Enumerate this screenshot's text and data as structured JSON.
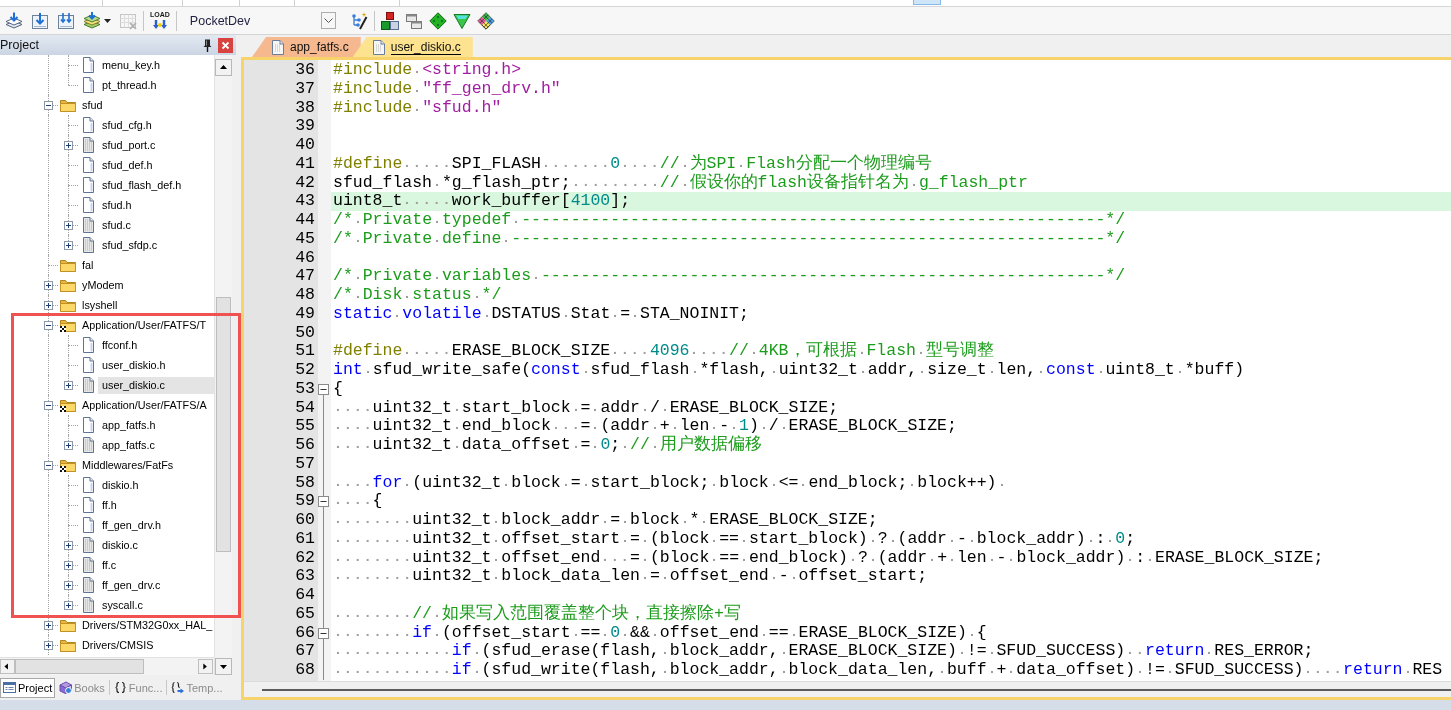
{
  "toolbar": {
    "groups": [
      {
        "buttons": [
          {
            "kind": "pages_arrow",
            "disabled": false
          },
          {
            "kind": "box_arrow",
            "disabled": false
          },
          {
            "kind": "box_arrows",
            "disabled": false
          },
          {
            "kind": "layers_arrow",
            "disabled": false
          },
          {
            "kind": "caret",
            "disabled": false
          },
          {
            "kind": "grid_cross",
            "disabled": true
          }
        ]
      },
      {
        "buttons": [
          {
            "kind": "load",
            "label": "LOAD",
            "disabled": false
          }
        ]
      },
      {
        "target": "PocketDev",
        "buttons": [
          {
            "kind": "wand",
            "disabled": false
          }
        ]
      },
      {
        "buttons": [
          {
            "kind": "blocks",
            "disabled": false
          },
          {
            "kind": "windows",
            "disabled": false
          },
          {
            "kind": "diamond",
            "disabled": false
          },
          {
            "kind": "funnel",
            "disabled": false
          },
          {
            "kind": "diamond_grid",
            "disabled": false
          }
        ]
      }
    ]
  },
  "project_panel": {
    "title": "Project",
    "tree": [
      {
        "highlighted": false,
        "children": [
          {
            "label": "menu_key.h",
            "kind": "header",
            "selected": false
          },
          {
            "label": "pt_thread.h",
            "kind": "header",
            "selected": false
          }
        ]
      },
      {
        "label": "sfud",
        "kind": "group",
        "expanded": true,
        "selected": false,
        "highlighted": false,
        "children": [
          {
            "label": "sfud_cfg.h",
            "kind": "header",
            "selected": false
          },
          {
            "label": "sfud_port.c",
            "kind": "source",
            "expanded": false,
            "selected": false
          },
          {
            "label": "sfud_def.h",
            "kind": "header",
            "selected": false
          },
          {
            "label": "sfud_flash_def.h",
            "kind": "header",
            "selected": false
          },
          {
            "label": "sfud.h",
            "kind": "header",
            "selected": false
          },
          {
            "label": "sfud.c",
            "kind": "source",
            "expanded": false,
            "selected": false
          },
          {
            "label": "sfud_sfdp.c",
            "kind": "source",
            "expanded": false,
            "selected": false
          }
        ]
      },
      {
        "label": "fal",
        "kind": "group",
        "selected": false,
        "highlighted": false
      },
      {
        "label": "yModem",
        "kind": "group",
        "expanded": false,
        "selected": false,
        "highlighted": false
      },
      {
        "label": "lsyshell",
        "kind": "group",
        "expanded": false,
        "selected": false,
        "highlighted": false
      },
      {
        "label": "Application/User/FATFS/T",
        "kind": "option_group",
        "expanded": true,
        "selected": false,
        "highlighted": true,
        "children": [
          {
            "label": "ffconf.h",
            "kind": "header",
            "selected": false
          },
          {
            "label": "user_diskio.h",
            "kind": "header",
            "selected": false
          },
          {
            "label": "user_diskio.c",
            "kind": "source",
            "expanded": false,
            "selected": true
          }
        ]
      },
      {
        "label": "Application/User/FATFS/A",
        "kind": "option_group",
        "expanded": true,
        "selected": false,
        "highlighted": true,
        "children": [
          {
            "label": "app_fatfs.h",
            "kind": "header",
            "selected": false
          },
          {
            "label": "app_fatfs.c",
            "kind": "source",
            "expanded": false,
            "selected": false
          }
        ]
      },
      {
        "label": "Middlewares/FatFs",
        "kind": "option_group",
        "expanded": true,
        "selected": false,
        "highlighted": true,
        "children": [
          {
            "label": "diskio.h",
            "kind": "header",
            "selected": false
          },
          {
            "label": "ff.h",
            "kind": "header",
            "selected": false
          },
          {
            "label": "ff_gen_drv.h",
            "kind": "header",
            "selected": false
          },
          {
            "label": "diskio.c",
            "kind": "source",
            "expanded": false,
            "selected": false
          },
          {
            "label": "ff.c",
            "kind": "source",
            "expanded": false,
            "selected": false
          },
          {
            "label": "ff_gen_drv.c",
            "kind": "source",
            "expanded": false,
            "selected": false
          },
          {
            "label": "syscall.c",
            "kind": "source",
            "expanded": false,
            "selected": false
          }
        ]
      },
      {
        "label": "Drivers/STM32G0xx_HAL_",
        "kind": "group",
        "expanded": false,
        "selected": false,
        "highlighted": false
      },
      {
        "label": "Drivers/CMSIS",
        "kind": "group",
        "expanded": false,
        "selected": false,
        "highlighted": false
      }
    ],
    "tabs": [
      {
        "label": "Project",
        "kind": "project",
        "selected": true
      },
      {
        "label": "Books",
        "kind": "books",
        "selected": false
      },
      {
        "label": "Func...",
        "kind": "functions",
        "selected": false
      },
      {
        "label": "Temp...",
        "kind": "templates",
        "selected": false
      }
    ]
  },
  "editor": {
    "tabs": [
      {
        "label": "app_fatfs.c",
        "selected": false
      },
      {
        "label": "user_diskio.c",
        "selected": true
      }
    ],
    "show_whitespace": true,
    "lines": [
      {
        "number": "36",
        "current": false,
        "fold_start": false,
        "segments": [
          {
            "text": "#include ",
            "kind": "preprocessor"
          },
          {
            "text": "<string.h>",
            "kind": "string"
          }
        ]
      },
      {
        "number": "37",
        "current": false,
        "fold_start": false,
        "segments": [
          {
            "text": "#include ",
            "kind": "preprocessor"
          },
          {
            "text": "\"ff_gen_drv.h\"",
            "kind": "string"
          }
        ]
      },
      {
        "number": "38",
        "current": false,
        "fold_start": false,
        "segments": [
          {
            "text": "#include ",
            "kind": "preprocessor"
          },
          {
            "text": "\"sfud.h\"",
            "kind": "string"
          }
        ]
      },
      {
        "number": "39",
        "current": false,
        "fold_start": false
      },
      {
        "number": "40",
        "current": false,
        "fold_start": false
      },
      {
        "number": "41",
        "current": false,
        "fold_start": false,
        "segments": [
          {
            "text": "#define     ",
            "kind": "preprocessor"
          },
          {
            "text": "SPI_FLASH       ",
            "kind": "plain"
          },
          {
            "text": "0",
            "kind": "number"
          },
          {
            "text": "    // 为SPI Flash分配一个物理编号",
            "kind": "comment"
          }
        ]
      },
      {
        "number": "42",
        "current": false,
        "fold_start": false,
        "segments": [
          {
            "text": "sfud_flash *g_flash_ptr;         ",
            "kind": "plain"
          },
          {
            "text": "// 假设你的flash设备指针名为 g_flash_ptr",
            "kind": "comment"
          }
        ]
      },
      {
        "number": "43",
        "current": true,
        "fold_start": false,
        "segments": [
          {
            "text": "uint8_t     work_buffer[",
            "kind": "plain"
          },
          {
            "text": "4100",
            "kind": "number"
          },
          {
            "text": "];",
            "kind": "plain"
          }
        ]
      },
      {
        "number": "44",
        "current": false,
        "fold_start": false,
        "segments": [
          {
            "text": "/* Private typedef -----------------------------------------------------------*/",
            "kind": "comment"
          }
        ]
      },
      {
        "number": "45",
        "current": false,
        "fold_start": false,
        "segments": [
          {
            "text": "/* Private define ------------------------------------------------------------*/",
            "kind": "comment"
          }
        ]
      },
      {
        "number": "46",
        "current": false,
        "fold_start": false
      },
      {
        "number": "47",
        "current": false,
        "fold_start": false,
        "segments": [
          {
            "text": "/* Private variables ---------------------------------------------------------*/",
            "kind": "comment"
          }
        ]
      },
      {
        "number": "48",
        "current": false,
        "fold_start": false,
        "segments": [
          {
            "text": "/* Disk status */",
            "kind": "comment"
          }
        ]
      },
      {
        "number": "49",
        "current": false,
        "fold_start": false,
        "segments": [
          {
            "text": "static volatile",
            "kind": "keyword"
          },
          {
            "text": " DSTATUS Stat = STA_NOINIT;",
            "kind": "plain"
          }
        ]
      },
      {
        "number": "50",
        "current": false,
        "fold_start": false
      },
      {
        "number": "51",
        "current": false,
        "fold_start": false,
        "segments": [
          {
            "text": "#define     ",
            "kind": "preprocessor"
          },
          {
            "text": "ERASE_BLOCK_SIZE    ",
            "kind": "plain"
          },
          {
            "text": "4096",
            "kind": "number"
          },
          {
            "text": "    // 4KB，可根据 Flash 型号调整",
            "kind": "comment"
          }
        ]
      },
      {
        "number": "52",
        "current": false,
        "fold_start": false,
        "segments": [
          {
            "text": "int",
            "kind": "keyword"
          },
          {
            "text": " sfud_write_safe(",
            "kind": "plain"
          },
          {
            "text": "const",
            "kind": "keyword"
          },
          {
            "text": " sfud_flash *flash, uint32_t addr, size_t len, ",
            "kind": "plain"
          },
          {
            "text": "const",
            "kind": "keyword"
          },
          {
            "text": " uint8_t *buff)",
            "kind": "plain"
          }
        ]
      },
      {
        "number": "53",
        "current": false,
        "fold_start": true,
        "segments": [
          {
            "text": "{",
            "kind": "plain"
          }
        ]
      },
      {
        "number": "54",
        "current": false,
        "fold_start": false,
        "segments": [
          {
            "text": "    uint32_t start_block = addr / ERASE_BLOCK_SIZE;",
            "kind": "plain"
          }
        ]
      },
      {
        "number": "55",
        "current": false,
        "fold_start": false,
        "segments": [
          {
            "text": "    uint32_t end_block   = (addr + len - ",
            "kind": "plain"
          },
          {
            "text": "1",
            "kind": "number"
          },
          {
            "text": ") / ERASE_BLOCK_SIZE;",
            "kind": "plain"
          }
        ]
      },
      {
        "number": "56",
        "current": false,
        "fold_start": false,
        "segments": [
          {
            "text": "    uint32_t data_offset = ",
            "kind": "plain"
          },
          {
            "text": "0",
            "kind": "number"
          },
          {
            "text": "; ",
            "kind": "plain"
          },
          {
            "text": "// 用户数据偏移",
            "kind": "comment"
          }
        ]
      },
      {
        "number": "57",
        "current": false,
        "fold_start": false
      },
      {
        "number": "58",
        "current": false,
        "fold_start": false,
        "segments": [
          {
            "text": "    for",
            "kind": "keyword"
          },
          {
            "text": " (uint32_t block = start_block; block <= end_block; block++) ",
            "kind": "plain"
          }
        ]
      },
      {
        "number": "59",
        "current": false,
        "fold_start": true,
        "segments": [
          {
            "text": "    {",
            "kind": "plain"
          }
        ]
      },
      {
        "number": "60",
        "current": false,
        "fold_start": false,
        "segments": [
          {
            "text": "        uint32_t block_addr = block * ERASE_BLOCK_SIZE;",
            "kind": "plain"
          }
        ]
      },
      {
        "number": "61",
        "current": false,
        "fold_start": false,
        "segments": [
          {
            "text": "        uint32_t offset_start = (block == start_block) ? (addr - block_addr) : ",
            "kind": "plain"
          },
          {
            "text": "0",
            "kind": "number"
          },
          {
            "text": ";",
            "kind": "plain"
          }
        ]
      },
      {
        "number": "62",
        "current": false,
        "fold_start": false,
        "segments": [
          {
            "text": "        uint32_t offset_end   = (block == end_block) ? (addr + len - block_addr) : ERASE_BLOCK_SIZE;",
            "kind": "plain"
          }
        ]
      },
      {
        "number": "63",
        "current": false,
        "fold_start": false,
        "segments": [
          {
            "text": "        uint32_t block_data_len = offset_end - offset_start;",
            "kind": "plain"
          }
        ]
      },
      {
        "number": "64",
        "current": false,
        "fold_start": false
      },
      {
        "number": "65",
        "current": false,
        "fold_start": false,
        "segments": [
          {
            "text": "        // 如果写入范围覆盖整个块，直接擦除+写",
            "kind": "comment"
          }
        ]
      },
      {
        "number": "66",
        "current": false,
        "fold_start": true,
        "segments": [
          {
            "text": "        if",
            "kind": "keyword"
          },
          {
            "text": " (offset_start == ",
            "kind": "plain"
          },
          {
            "text": "0",
            "kind": "number"
          },
          {
            "text": " && offset_end == ERASE_BLOCK_SIZE) {",
            "kind": "plain"
          }
        ]
      },
      {
        "number": "67",
        "current": false,
        "fold_start": false,
        "segments": [
          {
            "text": "            if",
            "kind": "keyword"
          },
          {
            "text": " (sfud_erase(flash, block_addr, ERASE_BLOCK_SIZE) != SFUD_SUCCESS)  ",
            "kind": "plain"
          },
          {
            "text": "return",
            "kind": "keyword"
          },
          {
            "text": " RES_ERROR;",
            "kind": "plain"
          }
        ]
      },
      {
        "number": "68",
        "current": false,
        "fold_start": false,
        "segments": [
          {
            "text": "            if",
            "kind": "keyword"
          },
          {
            "text": " (sfud_write(flash, block_addr, block_data_len, buff + data_offset) != SFUD_SUCCESS)    ",
            "kind": "plain"
          },
          {
            "text": "return",
            "kind": "keyword"
          },
          {
            "text": " RES",
            "kind": "plain"
          }
        ]
      }
    ]
  }
}
